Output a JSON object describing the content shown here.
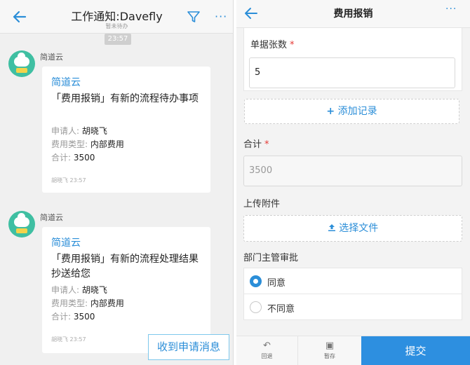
{
  "left": {
    "title": "工作通知:Davefly",
    "subtitle": "暂未待办",
    "time": "23:57",
    "messages": [
      {
        "sender": "简道云",
        "card_title": "简道云",
        "body": "「费用报销」有新的流程待办事项",
        "applicant_label": "申请人: ",
        "applicant": "胡晓飞",
        "type_label": "费用类型: ",
        "type": "内部费用",
        "total_label": "合计: ",
        "total": "3500",
        "footer": "胡晓飞 23:57"
      },
      {
        "sender": "简道云",
        "card_title": "简道云",
        "body": "「费用报销」有新的流程处理结果抄送给您",
        "applicant_label": "申请人: ",
        "applicant": "胡晓飞",
        "type_label": "费用类型: ",
        "type": "内部费用",
        "total_label": "合计: ",
        "total": "3500",
        "footer": "胡晓飞 23:57"
      }
    ],
    "inbox_button": "收到申请消息",
    "accent": "#2b8ed8"
  },
  "right": {
    "title": "费用报销",
    "receipt_count_label": "单据张数",
    "receipt_count_value": "5",
    "add_record": "添加记录",
    "total_label": "合计",
    "total_value": "3500",
    "attachment_label": "上传附件",
    "choose_file": "选择文件",
    "approval_label": "部门主管审批",
    "approve": "同意",
    "reject": "不同意",
    "approval_selected": "同意",
    "tab_back": "回退",
    "tab_save": "暂存",
    "submit": "提交",
    "required_mark": "*"
  }
}
